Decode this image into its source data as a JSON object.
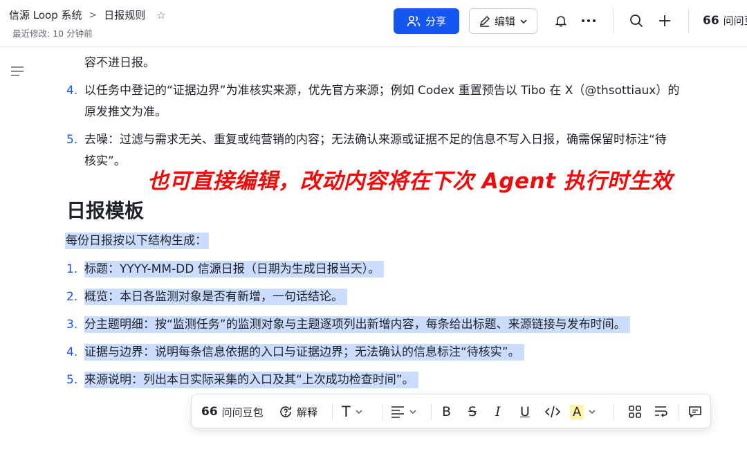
{
  "header": {
    "breadcrumb_root": "信源 Loop 系统",
    "breadcrumb_current": "日报规则",
    "breadcrumb_sep": ">",
    "pin_glyph": "☆",
    "modified": "最近修改: 10 分钟前",
    "share_label": "分享",
    "edit_label": "编辑",
    "ask_label": "问问豆",
    "ask_glyph": "66"
  },
  "doc": {
    "top_fragment": "容不进日报。",
    "rules": [
      {
        "num": "4.",
        "line1": "以任务中登记的“证据边界”为准核实来源，优先官方来源；例如 Codex 重置预告以 Tibo 在 X（@thsottiaux）的",
        "line2": "原发推文为准。"
      },
      {
        "num": "5.",
        "line1": "去噪：过滤与需求无关、重复或纯营销的内容；无法确认来源或证据不足的信息不写入日报，确需保留时标注“待",
        "line2": "核实”。"
      }
    ],
    "annotation": "也可直接编辑，改动内容将在下次 Agent 执行时生效",
    "template_heading": "日报模板",
    "template_intro": "每份日报按以下结构生成：",
    "template_items": [
      {
        "num": "1.",
        "text": "标题：YYYY-MM-DD 信源日报（日期为生成日报当天）。"
      },
      {
        "num": "2.",
        "text": "概览：本日各监测对象是否有新增，一句话结论。"
      },
      {
        "num": "3.",
        "text": "分主题明细：按“监测任务”的监测对象与主题逐项列出新增内容，每条给出标题、来源链接与发布时间。"
      },
      {
        "num": "4.",
        "text": "证据与边界：说明每条信息依据的入口与证据边界；无法确认的信息标注“待核实”。"
      },
      {
        "num": "5.",
        "text": "来源说明：列出本日实际采集的入口及其“上次成功检查时间”。"
      }
    ]
  },
  "toolbar": {
    "ask_label": "问问豆包",
    "ask_glyph": "66",
    "explain_label": "解释",
    "text_glyph": "T",
    "bold_glyph": "B",
    "strike_glyph": "S",
    "italic_glyph": "I",
    "underline_glyph": "U",
    "highlight_glyph": "A"
  },
  "colors": {
    "accent": "#1456f0",
    "selection": "#ccdcfe",
    "annotation": "#f00a0a",
    "highlight": "#fff3a8"
  }
}
